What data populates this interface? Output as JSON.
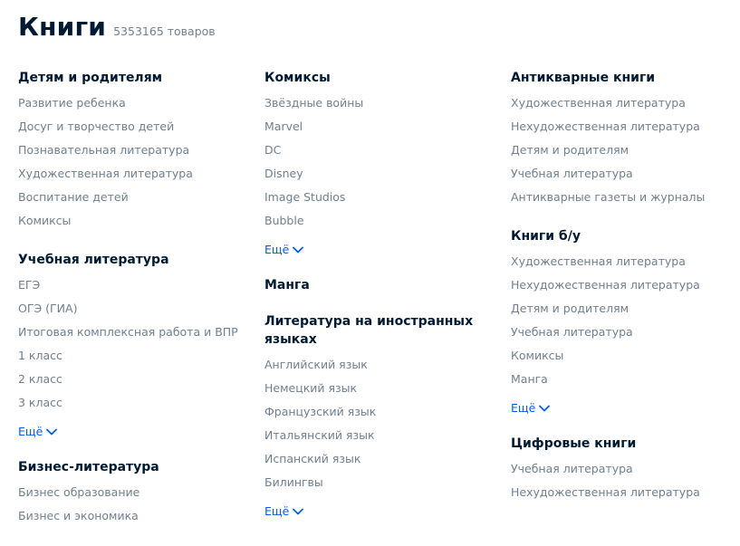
{
  "header": {
    "title": "Книги",
    "count": "5353165 товаров"
  },
  "more_label": "Ещё",
  "columns": [
    {
      "sections": [
        {
          "title": "Детям и родителям",
          "items": [
            "Развитие ребенка",
            "Досуг и творчество детей",
            "Познавательная литература",
            "Художественная литература",
            "Воспитание детей",
            "Комиксы"
          ]
        },
        {
          "title": "Учебная литература",
          "items": [
            "ЕГЭ",
            "ОГЭ (ГИА)",
            "Итоговая комплексная работа и ВПР",
            "1 класс",
            "2 класс",
            "3 класс"
          ],
          "more": true
        },
        {
          "title": "Бизнес-литература",
          "items": [
            "Бизнес образование",
            "Бизнес и экономика"
          ]
        }
      ]
    },
    {
      "sections": [
        {
          "title": "Комиксы",
          "items": [
            "Звёздные войны",
            "Marvel",
            "DC",
            "Disney",
            "Image Studios",
            "Bubble"
          ],
          "more": true
        },
        {
          "title": "Манга",
          "items": []
        },
        {
          "title": "Литература на иностранных языках",
          "items": [
            "Английский язык",
            "Немецкий язык",
            "Французский язык",
            "Итальянский язык",
            "Испанский язык",
            "Билингвы"
          ],
          "more": true
        }
      ]
    },
    {
      "sections": [
        {
          "title": "Антикварные книги",
          "items": [
            "Художественная литература",
            "Нехудожественная литература",
            "Детям и родителям",
            "Учебная литература",
            "Антикварные газеты и журналы"
          ]
        },
        {
          "title": "Книги б/у",
          "items": [
            "Художественная литература",
            "Нехудожественная литература",
            "Детям и родителям",
            "Учебная литература",
            "Комиксы",
            "Манга"
          ],
          "more": true
        },
        {
          "title": "Цифровые книги",
          "items": [
            "Учебная литература",
            "Нехудожественная литература"
          ]
        }
      ]
    }
  ],
  "colors": {
    "title": "#001a34",
    "item": "#707f8d",
    "link": "#005bff"
  },
  "icons": {
    "more": "chevron-down-icon"
  }
}
